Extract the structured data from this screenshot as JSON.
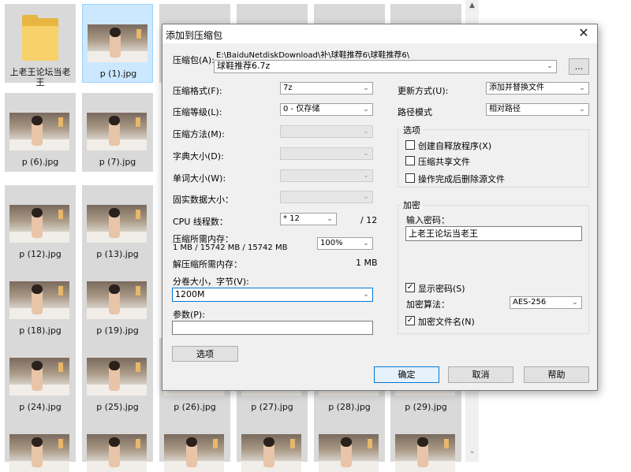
{
  "explorer": {
    "tiles": [
      {
        "label": "上老王论坛当老\n王",
        "kind": "folder"
      },
      {
        "label": "p (1).jpg",
        "kind": "image",
        "selected": true
      },
      {
        "label": "",
        "kind": "image"
      },
      {
        "label": "",
        "kind": "image"
      },
      {
        "label": "",
        "kind": "image"
      },
      {
        "label": "",
        "kind": "image"
      },
      {
        "label": "p (6).jpg",
        "kind": "image"
      },
      {
        "label": "p (7).jpg",
        "kind": "image"
      },
      {
        "label": "p (12).jpg",
        "kind": "image"
      },
      {
        "label": "p (13).jpg",
        "kind": "image"
      },
      {
        "label": "p (18).jpg",
        "kind": "image"
      },
      {
        "label": "p (19).jpg",
        "kind": "image"
      },
      {
        "label": "p (24).jpg",
        "kind": "image"
      },
      {
        "label": "p (25).jpg",
        "kind": "image"
      },
      {
        "label": "p (26).jpg",
        "kind": "image"
      },
      {
        "label": "p (27).jpg",
        "kind": "image"
      },
      {
        "label": "p (28).jpg",
        "kind": "image"
      },
      {
        "label": "p (29).jpg",
        "kind": "image"
      }
    ]
  },
  "dialog": {
    "title": "添加到压缩包",
    "close_glyph": "✕",
    "archive_label": "压缩包(A):",
    "archive_path": "E:\\BaiduNetdiskDownload\\补\\球鞋推荐6\\球鞋推荐6\\",
    "archive_name": "球鞋推荐6.7z",
    "browse_label": "...",
    "format_label": "压缩格式(F):",
    "format_value": "7z",
    "level_label": "压缩等级(L):",
    "level_value": "0 - 仅存储",
    "method_label": "压缩方法(M):",
    "dict_label": "字典大小(D):",
    "word_label": "单词大小(W):",
    "solid_label": "固实数据大小：",
    "threads_label": "CPU 线程数：",
    "threads_value": "* 12",
    "threads_max": "/ 12",
    "mem_comp_label": "压缩所需内存：",
    "mem_comp_value": "1 MB / 15742 MB / 15742 MB",
    "mem_percent": "100%",
    "mem_decomp_label": "解压缩所需内存：",
    "mem_decomp_value": "1 MB",
    "split_label": "分卷大小，字节(V):",
    "split_value": "1200M",
    "params_label": "参数(P):",
    "params_value": "",
    "options_button": "选项",
    "update_label": "更新方式(U):",
    "update_value": "添加并替换文件",
    "path_label": "路径模式",
    "path_value": "相对路径",
    "options_group": "选项",
    "opt_sfx": "创建自释放程序(X)",
    "opt_shared": "压缩共享文件",
    "opt_delete": "操作完成后删除源文件",
    "encrypt_group": "加密",
    "password_label": "输入密码：",
    "password_value": "上老王论坛当老王",
    "show_password": "显示密码(S)",
    "algo_label": "加密算法：",
    "algo_value": "AES-256",
    "encrypt_names": "加密文件名(N)",
    "ok_button": "确定",
    "cancel_button": "取消",
    "help_button": "帮助",
    "check_glyph": "✓",
    "arrow_glyph": "⌄"
  },
  "scroll": {
    "up": "▲",
    "down": "⌄"
  }
}
